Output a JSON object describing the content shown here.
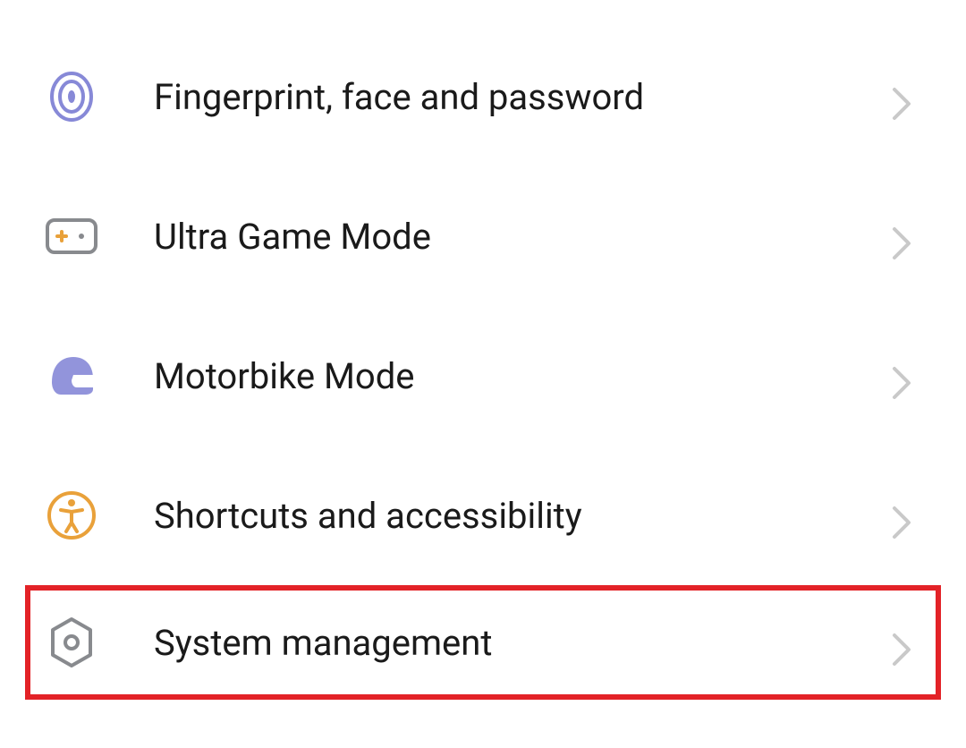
{
  "settings": {
    "items": [
      {
        "label": "Fingerprint, face and password",
        "icon": "fingerprint-icon",
        "highlight": false
      },
      {
        "label": "Ultra Game Mode",
        "icon": "gamepad-icon",
        "highlight": false
      },
      {
        "label": "Motorbike Mode",
        "icon": "helmet-icon",
        "highlight": false
      },
      {
        "label": "Shortcuts and accessibility",
        "icon": "accessibility-icon",
        "highlight": false
      },
      {
        "label": "System management",
        "icon": "settings-gear-icon",
        "highlight": true
      }
    ]
  },
  "colors": {
    "purple": "#8789d7",
    "orange": "#e9a13a",
    "gray": "#888a8e",
    "chevron": "#c9c9c9",
    "highlight": "#e32227"
  }
}
